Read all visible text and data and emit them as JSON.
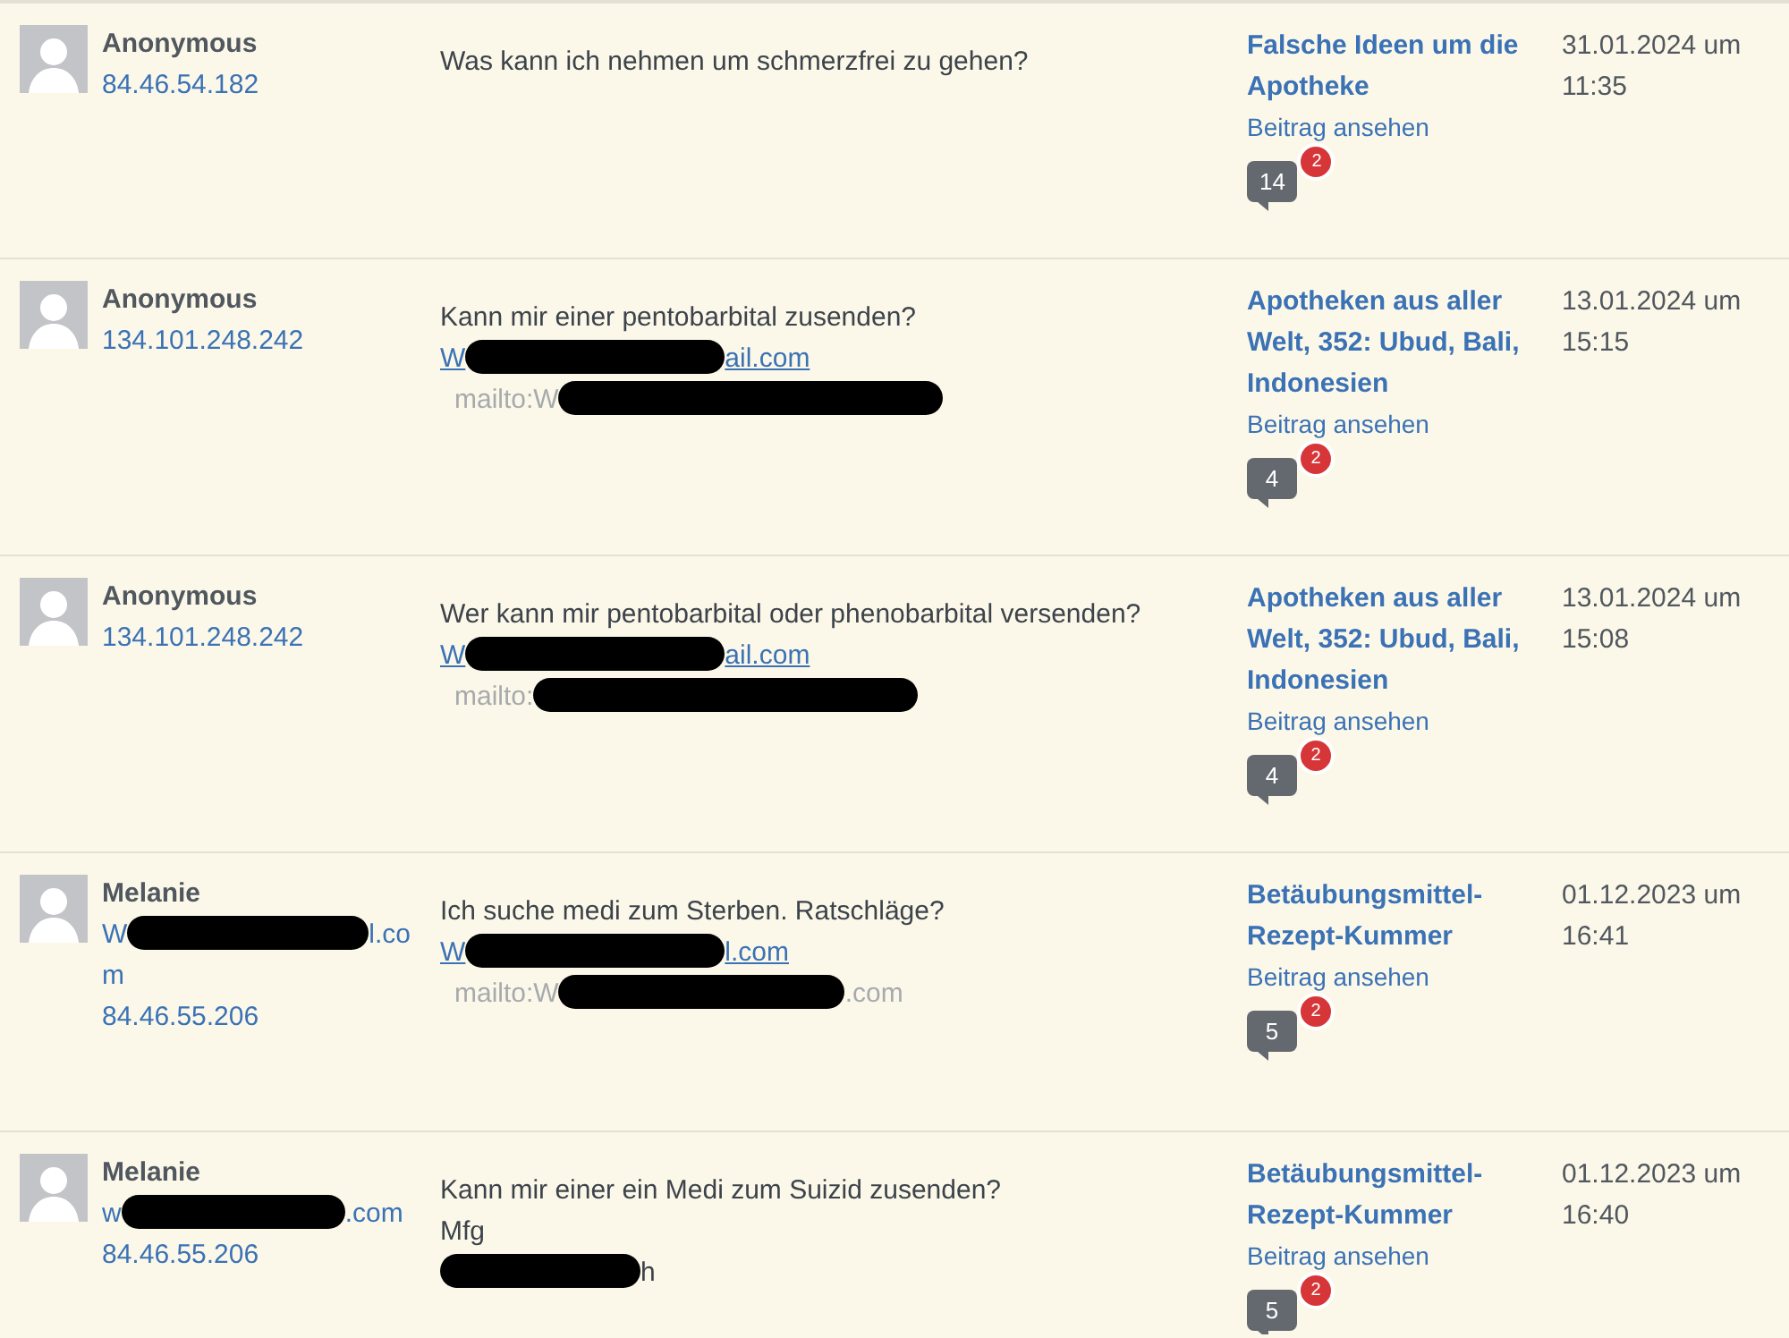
{
  "comments": [
    {
      "author": "Anonymous",
      "ip": "84.46.54.182",
      "lines": [
        {
          "kind": "text",
          "text": "Was kann ich nehmen um schmerzfrei zu gehen?"
        }
      ],
      "post_title": "Falsche Ideen um die Apotheke",
      "view_label": "Beitrag ansehen",
      "count": "14",
      "pending": "2",
      "date": "31.01.2024 um 11:35"
    },
    {
      "author": "Anonymous",
      "ip": "134.101.248.242",
      "lines": [
        {
          "kind": "text",
          "text": "Kann mir einer pentobarbital zusenden?"
        },
        {
          "kind": "link",
          "before": "W",
          "after": "ail.com"
        },
        {
          "kind": "mailto",
          "before": "mailto:W"
        }
      ],
      "post_title": "Apotheken aus aller Welt, 352: Ubud, Bali, Indonesien",
      "view_label": "Beitrag ansehen",
      "count": "4",
      "pending": "2",
      "date": "13.01.2024 um 15:15"
    },
    {
      "author": "Anonymous",
      "ip": "134.101.248.242",
      "lines": [
        {
          "kind": "text",
          "text": "Wer kann mir pentobarbital oder phenobarbital versenden?"
        },
        {
          "kind": "link",
          "before": "W",
          "after": "ail.com"
        },
        {
          "kind": "mailto",
          "before": "mailto:"
        }
      ],
      "post_title": "Apotheken aus aller Welt, 352: Ubud, Bali, Indonesien",
      "view_label": "Beitrag ansehen",
      "count": "4",
      "pending": "2",
      "date": "13.01.2024 um 15:08"
    },
    {
      "author": "Melanie",
      "email": {
        "before": "W",
        "after": "l.co",
        "wrapped": "m"
      },
      "ip": "84.46.55.206",
      "lines": [
        {
          "kind": "text",
          "text": "Ich suche medi zum Sterben. Ratschläge?"
        },
        {
          "kind": "link",
          "before": "W",
          "after": "l.com"
        },
        {
          "kind": "mailto",
          "before": "mailto:W",
          "after": ".com"
        }
      ],
      "post_title": "Betäubungsmittel-Rezept-Kummer",
      "view_label": "Beitrag ansehen",
      "count": "5",
      "pending": "2",
      "date": "01.12.2023 um 16:41"
    },
    {
      "author": "Melanie",
      "email": {
        "before": "w",
        "after": ".com"
      },
      "ip": "84.46.55.206",
      "lines": [
        {
          "kind": "text",
          "text": "Kann mir einer ein Medi zum Suizid zusenden?"
        },
        {
          "kind": "text",
          "text": "Mfg"
        },
        {
          "kind": "redacted",
          "after": "h"
        }
      ],
      "post_title": "Betäubungsmittel-Rezept-Kummer",
      "view_label": "Beitrag ansehen",
      "count": "5",
      "pending": "2",
      "date": "01.12.2023 um 16:40"
    }
  ]
}
